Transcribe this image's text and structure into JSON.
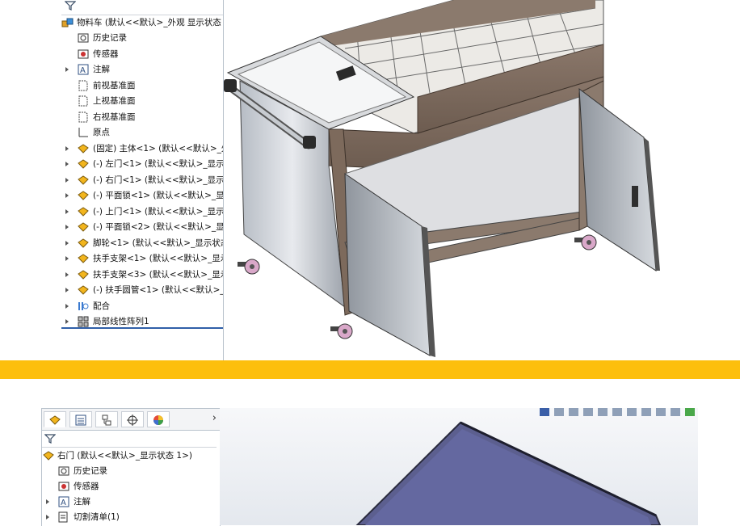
{
  "top_tree": {
    "root_label": "物料车 (默认<<默认>_外观 显示状态",
    "items": [
      {
        "label": "历史记录",
        "icon": "history-icon"
      },
      {
        "label": "传感器",
        "icon": "sensor-icon"
      },
      {
        "label": "注解",
        "icon": "annotation-icon"
      },
      {
        "label": "前视基准面",
        "icon": "plane-icon"
      },
      {
        "label": "上视基准面",
        "icon": "plane-icon"
      },
      {
        "label": "右视基准面",
        "icon": "plane-icon"
      },
      {
        "label": "原点",
        "icon": "origin-icon"
      },
      {
        "label": "(固定) 主体<1> (默认<<默认>_外",
        "icon": "part-icon"
      },
      {
        "label": "(-) 左门<1> (默认<<默认>_显示状",
        "icon": "part-icon"
      },
      {
        "label": "(-) 右门<1> (默认<<默认>_显示状",
        "icon": "part-icon"
      },
      {
        "label": "(-) 平面锁<1> (默认<<默认>_显示",
        "icon": "part-icon"
      },
      {
        "label": "(-) 上门<1> (默认<<默认>_显示状",
        "icon": "part-icon"
      },
      {
        "label": "(-) 平面锁<2> (默认<<默认>_显示",
        "icon": "part-icon"
      },
      {
        "label": "脚轮<1> (默认<<默认>_显示状态",
        "icon": "part-icon"
      },
      {
        "label": "扶手支架<1> (默认<<默认>_显示",
        "icon": "part-icon"
      },
      {
        "label": "扶手支架<3> (默认<<默认>_显示",
        "icon": "part-icon"
      },
      {
        "label": "(-) 扶手圆管<1> (默认<<默认>_显",
        "icon": "part-icon"
      },
      {
        "label": "配合",
        "icon": "mate-icon"
      },
      {
        "label": "局部线性阵列1",
        "icon": "pattern-icon"
      }
    ]
  },
  "bottom_tree": {
    "tabs": [
      "feature-manager-tab",
      "property-manager-tab",
      "configuration-manager-tab",
      "dimxpert-tab",
      "display-manager-tab"
    ],
    "root_label": "右门 (默认<<默认>_显示状态 1>)",
    "items": [
      {
        "label": "历史记录",
        "icon": "history-icon"
      },
      {
        "label": "传感器",
        "icon": "sensor-icon"
      },
      {
        "label": "注解",
        "icon": "annotation-icon"
      },
      {
        "label": "切割清单(1)",
        "icon": "cut-list-icon"
      }
    ]
  },
  "colors": {
    "band": "#fdbf0d",
    "cart_brown": "#7d6a5c",
    "steel": "#c9cdd3",
    "door_panel": "#5c5f8f",
    "tree_selection_line": "#2f5fa8"
  }
}
